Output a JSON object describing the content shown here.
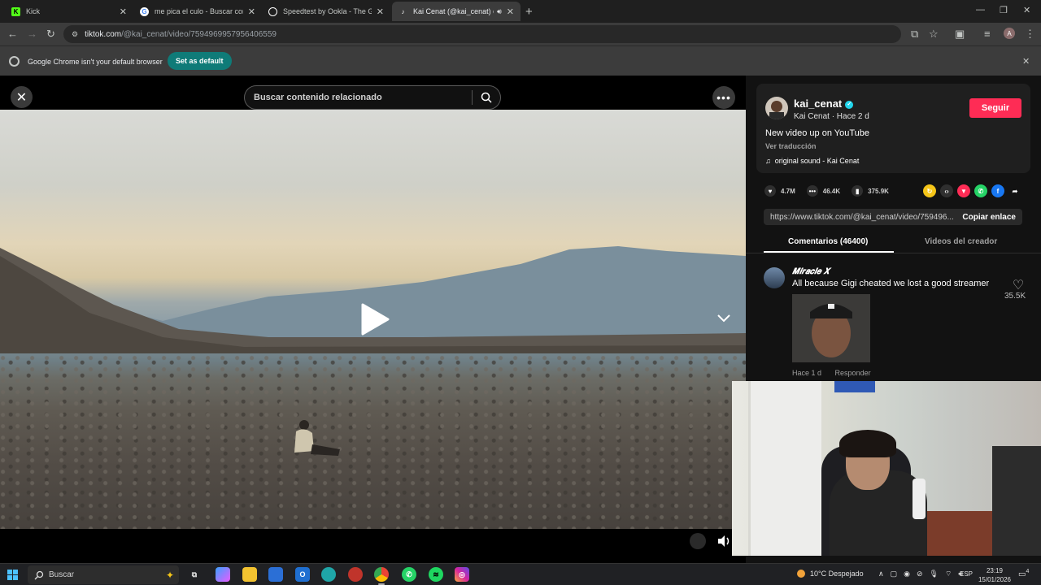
{
  "browser": {
    "tabs": [
      {
        "title": "Kick",
        "favicon": "kick-icon",
        "color": "#53fc18"
      },
      {
        "title": "me pica el culo - Buscar con Go",
        "favicon": "google-icon",
        "color": "#ffffff"
      },
      {
        "title": "Speedtest by Ookla - The Glob",
        "favicon": "speedtest-icon",
        "color": "#ffffff"
      },
      {
        "title": "Kai Cenat (@kai_cenat) ofic",
        "favicon": "tiktok-icon",
        "color": "#ffffff",
        "active": true,
        "audio": "speaker-icon"
      }
    ],
    "new_tab": "+",
    "url_host": "tiktok.com",
    "url_path": "/@kai_cenat/video/7594969957956406559",
    "profile_initial": "A"
  },
  "infobar": {
    "message": "Google Chrome isn't your default browser",
    "button": "Set as default"
  },
  "video": {
    "search_placeholder": "Buscar contenido relacionado",
    "more": "•••"
  },
  "creator": {
    "username": "kai_cenat",
    "sub": "Kai Cenat · Hace 2 d",
    "follow": "Seguir",
    "description": "New video up on YouTube",
    "translate": "Ver traducción",
    "sound": "original sound - Kai Cenat"
  },
  "stats": {
    "likes": "4.7M",
    "comments": "46.4K",
    "saves": "375.9K"
  },
  "share": {
    "url": "https://www.tiktok.com/@kai_cenat/video/759496...",
    "copy": "Copiar enlace"
  },
  "tabs": {
    "comments": "Comentarios (46400)",
    "creator_videos": "Videos del creador"
  },
  "comment": {
    "user": "𝑴𝒊𝒓𝒂𝒄𝒍𝒆 𝑿",
    "text": "All because Gigi cheated we lost a good streamer",
    "time": "Hace 1 d",
    "reply": "Responder",
    "likes": "35.5K"
  },
  "taskbar": {
    "search": "Buscar",
    "weather": "10°C  Despejado",
    "lang": "ESP",
    "time": "23:19",
    "date": "15/01/2026",
    "notifications": "4"
  }
}
